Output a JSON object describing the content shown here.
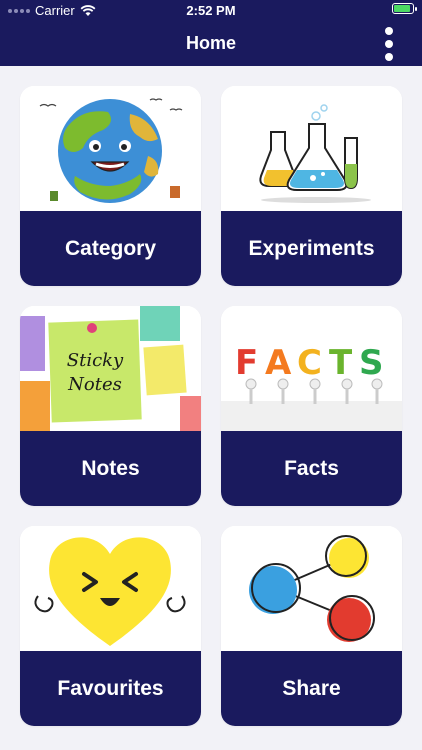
{
  "status_bar": {
    "carrier": "Carrier",
    "time": "2:52 PM"
  },
  "header": {
    "title": "Home",
    "menu_icon": "more-vertical-icon"
  },
  "colors": {
    "primary": "#1a1a5e",
    "background": "#f2f2f7",
    "battery": "#4cd964"
  },
  "cards": [
    {
      "label": "Category",
      "icon": "earth-icon"
    },
    {
      "label": "Experiments",
      "icon": "flask-icon"
    },
    {
      "label": "Notes",
      "icon": "sticky-notes-icon",
      "image_text": "Sticky Notes"
    },
    {
      "label": "Facts",
      "icon": "facts-icon",
      "image_text": "FACTS"
    },
    {
      "label": "Favourites",
      "icon": "heart-icon"
    },
    {
      "label": "Share",
      "icon": "share-icon"
    }
  ]
}
